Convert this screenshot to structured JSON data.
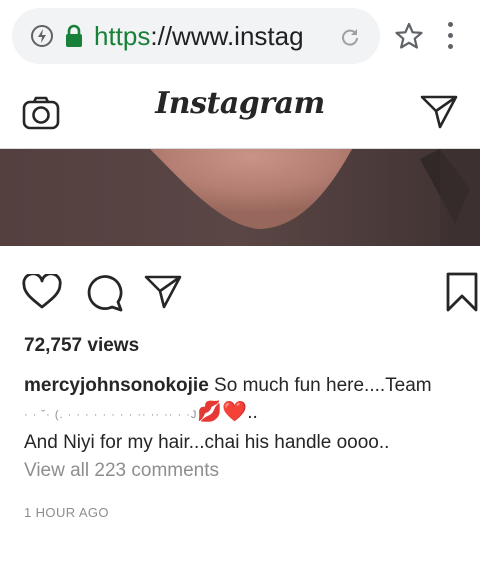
{
  "browser": {
    "url_scheme": "https",
    "url_rest": "://www.instag",
    "icons": {
      "info": "info-icon",
      "lock": "lock-icon",
      "reload": "reload-icon",
      "star": "bookmark-star-icon",
      "menu": "more-vert-icon"
    },
    "colors": {
      "secure_green": "#188038",
      "pill_bg": "#f1f3f4"
    }
  },
  "header": {
    "logo": "Instagram",
    "icons": {
      "left": "camera-icon",
      "right": "direct-message-icon"
    }
  },
  "post": {
    "actions": {
      "icons": [
        "heart-icon",
        "comment-icon",
        "share-icon",
        "bookmark-icon"
      ]
    },
    "views": "72,757 views",
    "caption": {
      "username": "mercyjohnsonokojie",
      "line1_text": " So much fun here....Team",
      "line2_obscured": "· · ˘· (. · · · · · · · · ·· ·· ·· · ·J",
      "line2_emojis": "💋❤️",
      "line2_tail": "..",
      "line3": "And Niyi for my hair...chai his handle oooo.."
    },
    "view_comments": "View all 223 comments",
    "timestamp": "1 HOUR AGO"
  },
  "colors": {
    "text_primary": "#262626",
    "text_secondary": "#8e8e8e",
    "divider": "#dbdbdb"
  }
}
